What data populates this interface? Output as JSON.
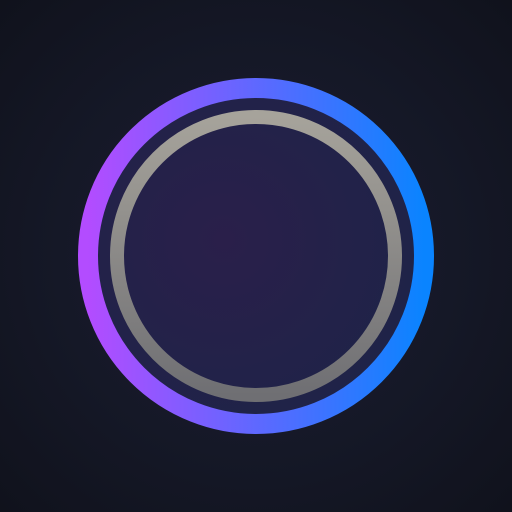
{
  "icon": {
    "name": "ring-logo-icon",
    "colors": {
      "background": "#131622",
      "outer_ring_start": "#b34cff",
      "outer_ring_end": "#0a84ff",
      "inner_ring_top": "#a6a39b",
      "inner_ring_bottom": "#6f6f73",
      "center_start": "#2a1f4a",
      "center_end": "#1d2448"
    }
  }
}
